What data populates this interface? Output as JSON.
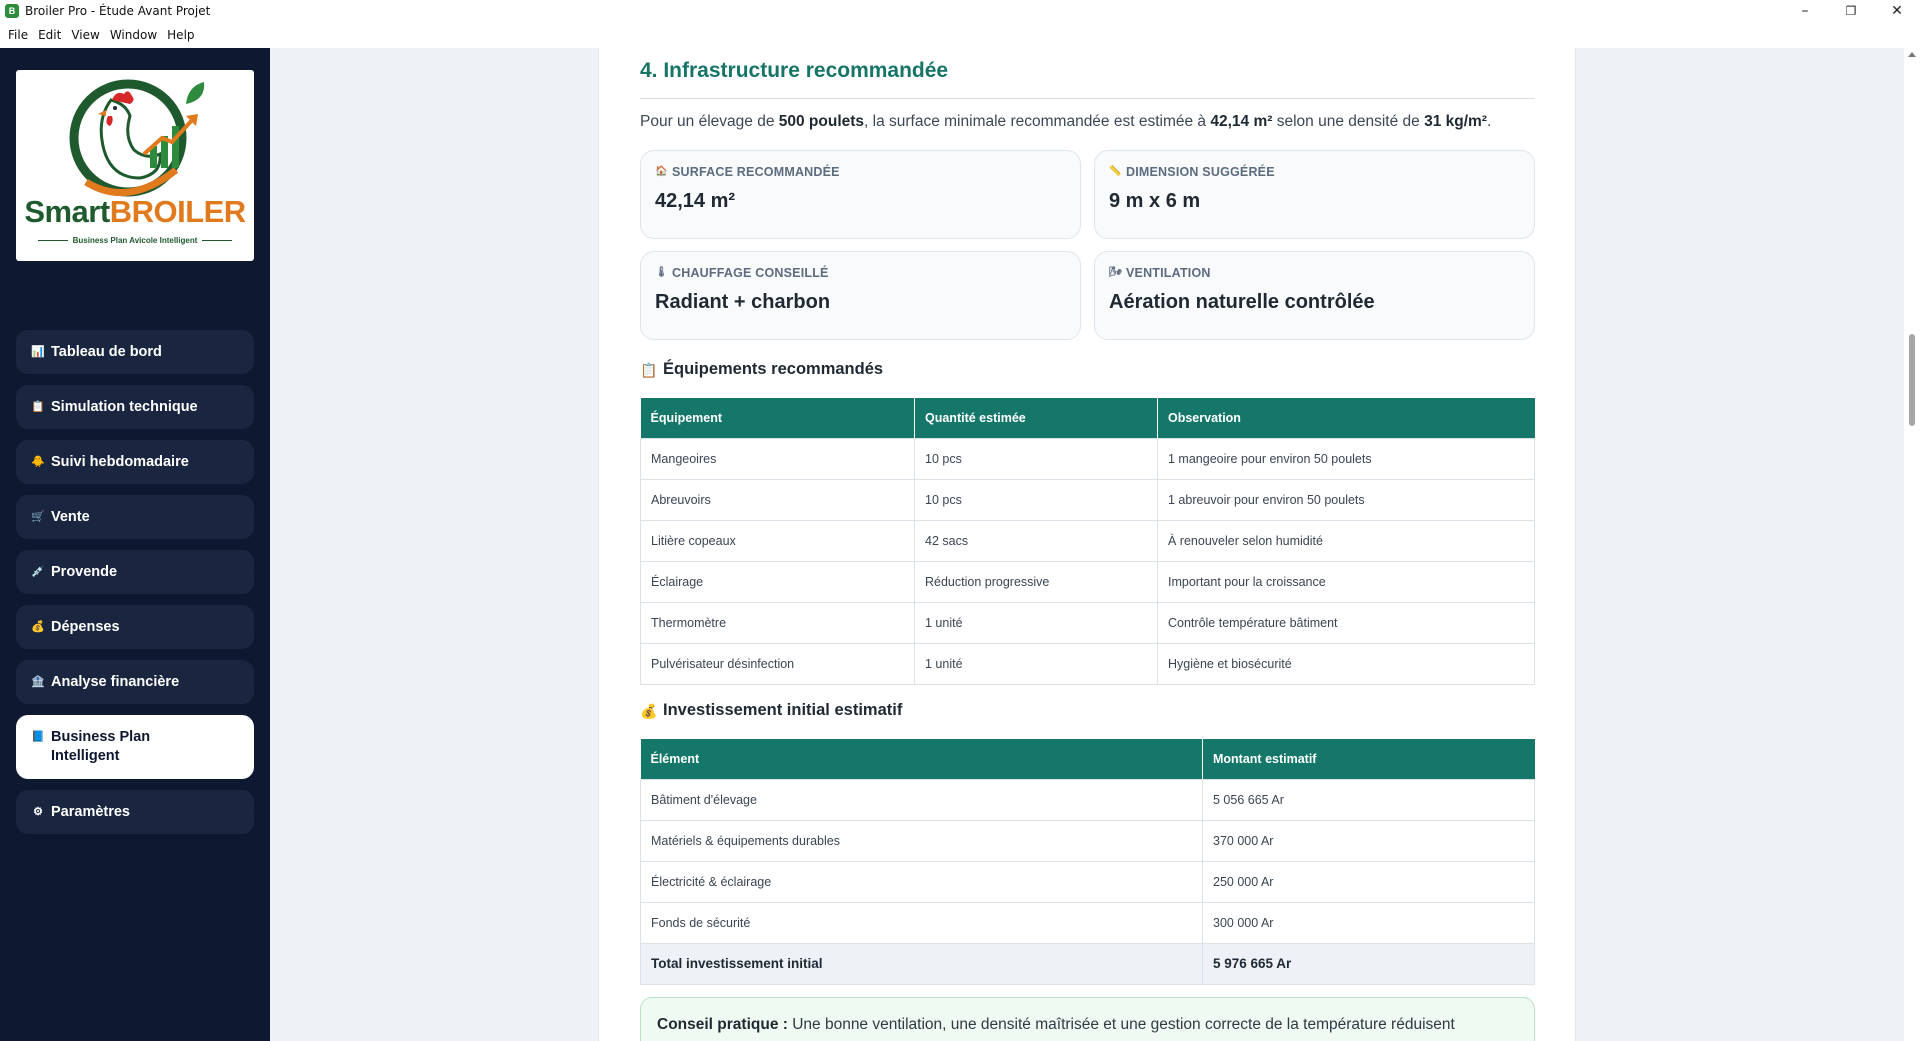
{
  "window": {
    "title": "Broiler Pro - Étude Avant Projet",
    "controls": {
      "minimize": "–",
      "maximize": "❐",
      "close": "✕"
    }
  },
  "menu": [
    "File",
    "Edit",
    "View",
    "Window",
    "Help"
  ],
  "logo": {
    "word_smart": "Smart",
    "word_broiler": "BROILER",
    "tagline": "Business Plan Avicole Intelligent"
  },
  "sidebar": {
    "items": [
      {
        "label": "Tableau de bord",
        "icon": "bar-chart-icon",
        "glyph": "📊"
      },
      {
        "label": "Simulation technique",
        "icon": "clipboard-icon",
        "glyph": "📋"
      },
      {
        "label": "Suivi hebdomadaire",
        "icon": "chick-icon",
        "glyph": "🐥"
      },
      {
        "label": "Vente",
        "icon": "cart-icon",
        "glyph": "🛒"
      },
      {
        "label": "Provende",
        "icon": "syringe-icon",
        "glyph": "💉"
      },
      {
        "label": "Dépenses",
        "icon": "money-bag-icon",
        "glyph": "💰"
      },
      {
        "label": "Analyse financière",
        "icon": "bank-icon",
        "glyph": "🏦"
      },
      {
        "label": "Business Plan Intelligent",
        "icon": "book-icon",
        "glyph": "📘",
        "active": true
      },
      {
        "label": "Paramètres",
        "icon": "gear-icon",
        "glyph": "⚙"
      }
    ]
  },
  "section": {
    "title": "4. Infrastructure recommandée",
    "intro_pre": "Pour un élevage de ",
    "intro_poulets": "500 poulets",
    "intro_mid": ", la surface minimale recommandée est estimée à ",
    "intro_surface": "42,14 m²",
    "intro_mid2": " selon une densité de ",
    "intro_density": "31 kg/m²",
    "intro_end": "."
  },
  "cards": [
    {
      "label": "SURFACE RECOMMANDÉE",
      "value": "42,14 m²",
      "icon": "house-icon",
      "glyph": "🏠"
    },
    {
      "label": "DIMENSION SUGGÉRÉE",
      "value": "9 m x 6 m",
      "icon": "ruler-icon",
      "glyph": "📏"
    },
    {
      "label": "CHAUFFAGE CONSEILLÉ",
      "value": "Radiant + charbon",
      "icon": "thermometer-icon",
      "glyph": "🌡"
    },
    {
      "label": "VENTILATION",
      "value": "Aération naturelle contrôlée",
      "icon": "wind-icon",
      "glyph": "🌬"
    }
  ],
  "equipment": {
    "title": "Équipements recommandés",
    "icon": "clipboard-icon",
    "glyph": "📋",
    "headers": [
      "Équipement",
      "Quantité estimée",
      "Observation"
    ],
    "rows": [
      [
        "Mangeoires",
        "10 pcs",
        "1 mangeoire pour environ 50 poulets"
      ],
      [
        "Abreuvoirs",
        "10 pcs",
        "1 abreuvoir pour environ 50 poulets"
      ],
      [
        "Litière copeaux",
        "42 sacs",
        "À renouveler selon humidité"
      ],
      [
        "Éclairage",
        "Réduction progressive",
        "Important pour la croissance"
      ],
      [
        "Thermomètre",
        "1 unité",
        "Contrôle température bâtiment"
      ],
      [
        "Pulvérisateur désinfection",
        "1 unité",
        "Hygiène et biosécurité"
      ]
    ]
  },
  "investment": {
    "title": "Investissement initial estimatif",
    "icon": "money-bag-icon",
    "glyph": "💰",
    "headers": [
      "Élément",
      "Montant estimatif"
    ],
    "rows": [
      [
        "Bâtiment d'élevage",
        "5 056 665 Ar"
      ],
      [
        "Matériels & équipements durables",
        "370 000 Ar"
      ],
      [
        "Électricité & éclairage",
        "250 000 Ar"
      ],
      [
        "Fonds de sécurité",
        "300 000 Ar"
      ]
    ],
    "total_label": "Total investissement initial",
    "total_value": "5 976 665 Ar"
  },
  "advice": {
    "label": "Conseil pratique :",
    "text": " Une bonne ventilation, une densité maîtrisée et une gestion correcte de la température réduisent"
  }
}
